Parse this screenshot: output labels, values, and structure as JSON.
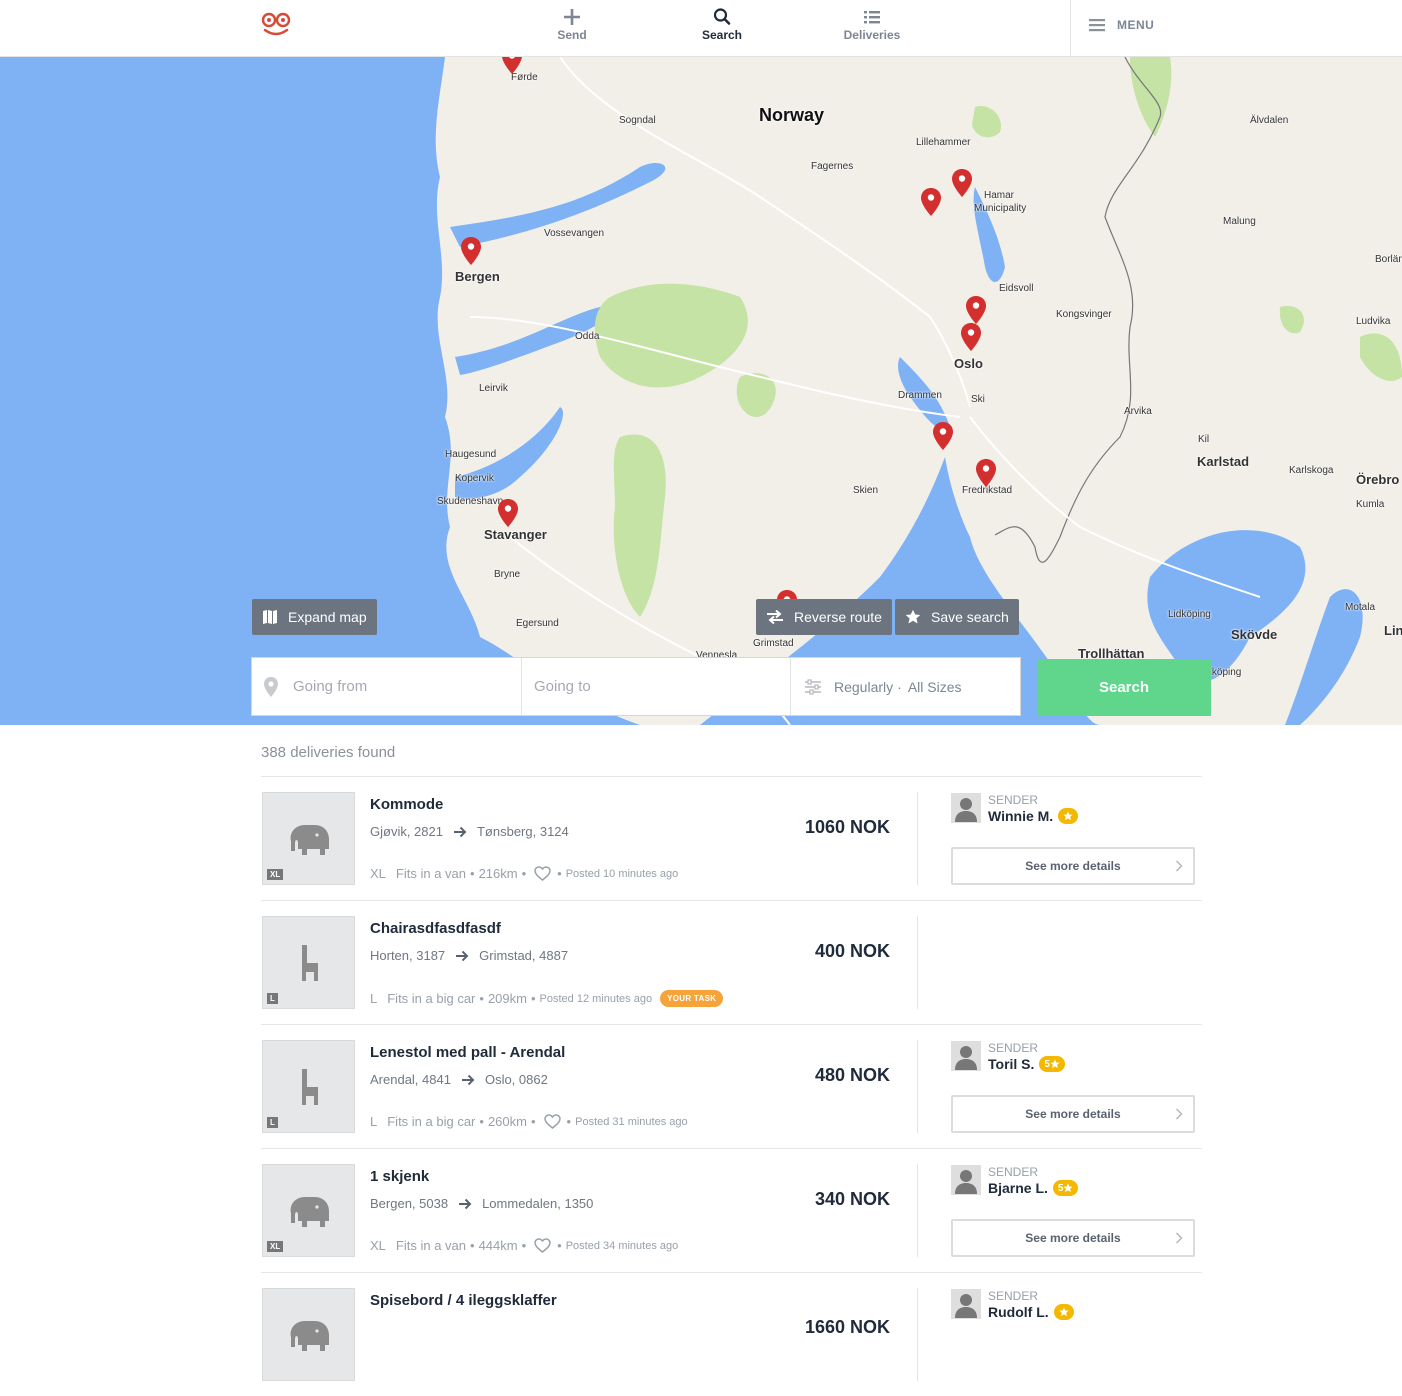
{
  "nav": {
    "send": "Send",
    "search": "Search",
    "deliveries": "Deliveries",
    "menu": "MENU"
  },
  "map": {
    "labels": {
      "norway": "Norway",
      "forde": "Førde",
      "sogndal": "Sogndal",
      "lillehammer": "Lillehammer",
      "fagernes": "Fagernes",
      "hamar": "Hamar",
      "municipality": "Municipality",
      "alvdalen": "Älvdalen",
      "malung": "Malung",
      "borlange": "Borlän",
      "vossevangen": "Vossevangen",
      "bergen": "Bergen",
      "eidsvoll": "Eidsvoll",
      "kongsvinger": "Kongsvinger",
      "ludvika": "Ludvika",
      "odda": "Odda",
      "oslo": "Oslo",
      "leirvik": "Leirvik",
      "drammen": "Drammen",
      "ski": "Ski",
      "arvika": "Arvika",
      "kil": "Kil",
      "karlstad": "Karlstad",
      "karlskoga": "Karlskoga",
      "orebro": "Örebro",
      "haugesund": "Haugesund",
      "kopervik": "Kopervik",
      "skudeneshavn": "Skudeneshavn",
      "stavanger": "Stavanger",
      "skien": "Skien",
      "fredrikstad": "Fredrikstad",
      "kumla": "Kumla",
      "bryne": "Bryne",
      "egersund": "Egersund",
      "grimstad": "Grimstad",
      "vennesla": "Vennesla",
      "lidkoping": "Lidköping",
      "skovde": "Skövde",
      "motala": "Motala",
      "lin": "Lin",
      "trollhattan": "Trollhättan",
      "falkoping": "Falköping"
    },
    "expand_map": "Expand map",
    "reverse_route": "Reverse route",
    "save_search": "Save search"
  },
  "search": {
    "going_from_placeholder": "Going from",
    "going_to_placeholder": "Going to",
    "frequency": "Regularly",
    "separator": "·",
    "sizes": "All Sizes",
    "button": "Search"
  },
  "results": {
    "count_text": "388 deliveries found",
    "sender_label": "SENDER",
    "details_label": "See more details",
    "items": [
      {
        "title": "Kommode",
        "from": "Gjøvik, 2821",
        "to": "Tønsberg, 3124",
        "size": "XL",
        "fits": "Fits in a van",
        "distance": "216km",
        "posted": "Posted 10 minutes ago",
        "price": "1060 NOK",
        "icon": "elephant-icon",
        "sender": "Winnie M.",
        "rating": ""
      },
      {
        "title": "Chairasdfasdfasdf",
        "from": "Horten, 3187",
        "to": "Grimstad, 4887",
        "size": "L",
        "fits": "Fits in a big car",
        "distance": "209km",
        "posted": "Posted 12 minutes ago",
        "badge": "YOUR TASK",
        "price": "400 NOK",
        "icon": "chair-icon"
      },
      {
        "title": "Lenestol med pall - Arendal",
        "from": "Arendal, 4841",
        "to": "Oslo, 0862",
        "size": "L",
        "fits": "Fits in a big car",
        "distance": "260km",
        "posted": "Posted 31 minutes ago",
        "price": "480 NOK",
        "icon": "chair-icon",
        "sender": "Toril S.",
        "rating": "5"
      },
      {
        "title": "1 skjenk",
        "from": "Bergen, 5038",
        "to": "Lommedalen, 1350",
        "size": "XL",
        "fits": "Fits in a van",
        "distance": "444km",
        "posted": "Posted 34 minutes ago",
        "price": "340 NOK",
        "icon": "elephant-icon",
        "sender": "Bjarne L.",
        "rating": "5"
      },
      {
        "title": "Spisebord / 4 ileggsklaffer",
        "from": "",
        "to": "",
        "price": "1660 NOK",
        "icon": "elephant-icon",
        "sender": "Rudolf L.",
        "rating": ""
      }
    ]
  },
  "colors": {
    "accent_green": "#5fd68c",
    "pin_red": "#d32f2f",
    "water": "#7fb1f5",
    "land": "#f2efe9",
    "park": "#c5e3a4",
    "badge_orange": "#f6a43a",
    "star_yellow": "#f5b800"
  }
}
